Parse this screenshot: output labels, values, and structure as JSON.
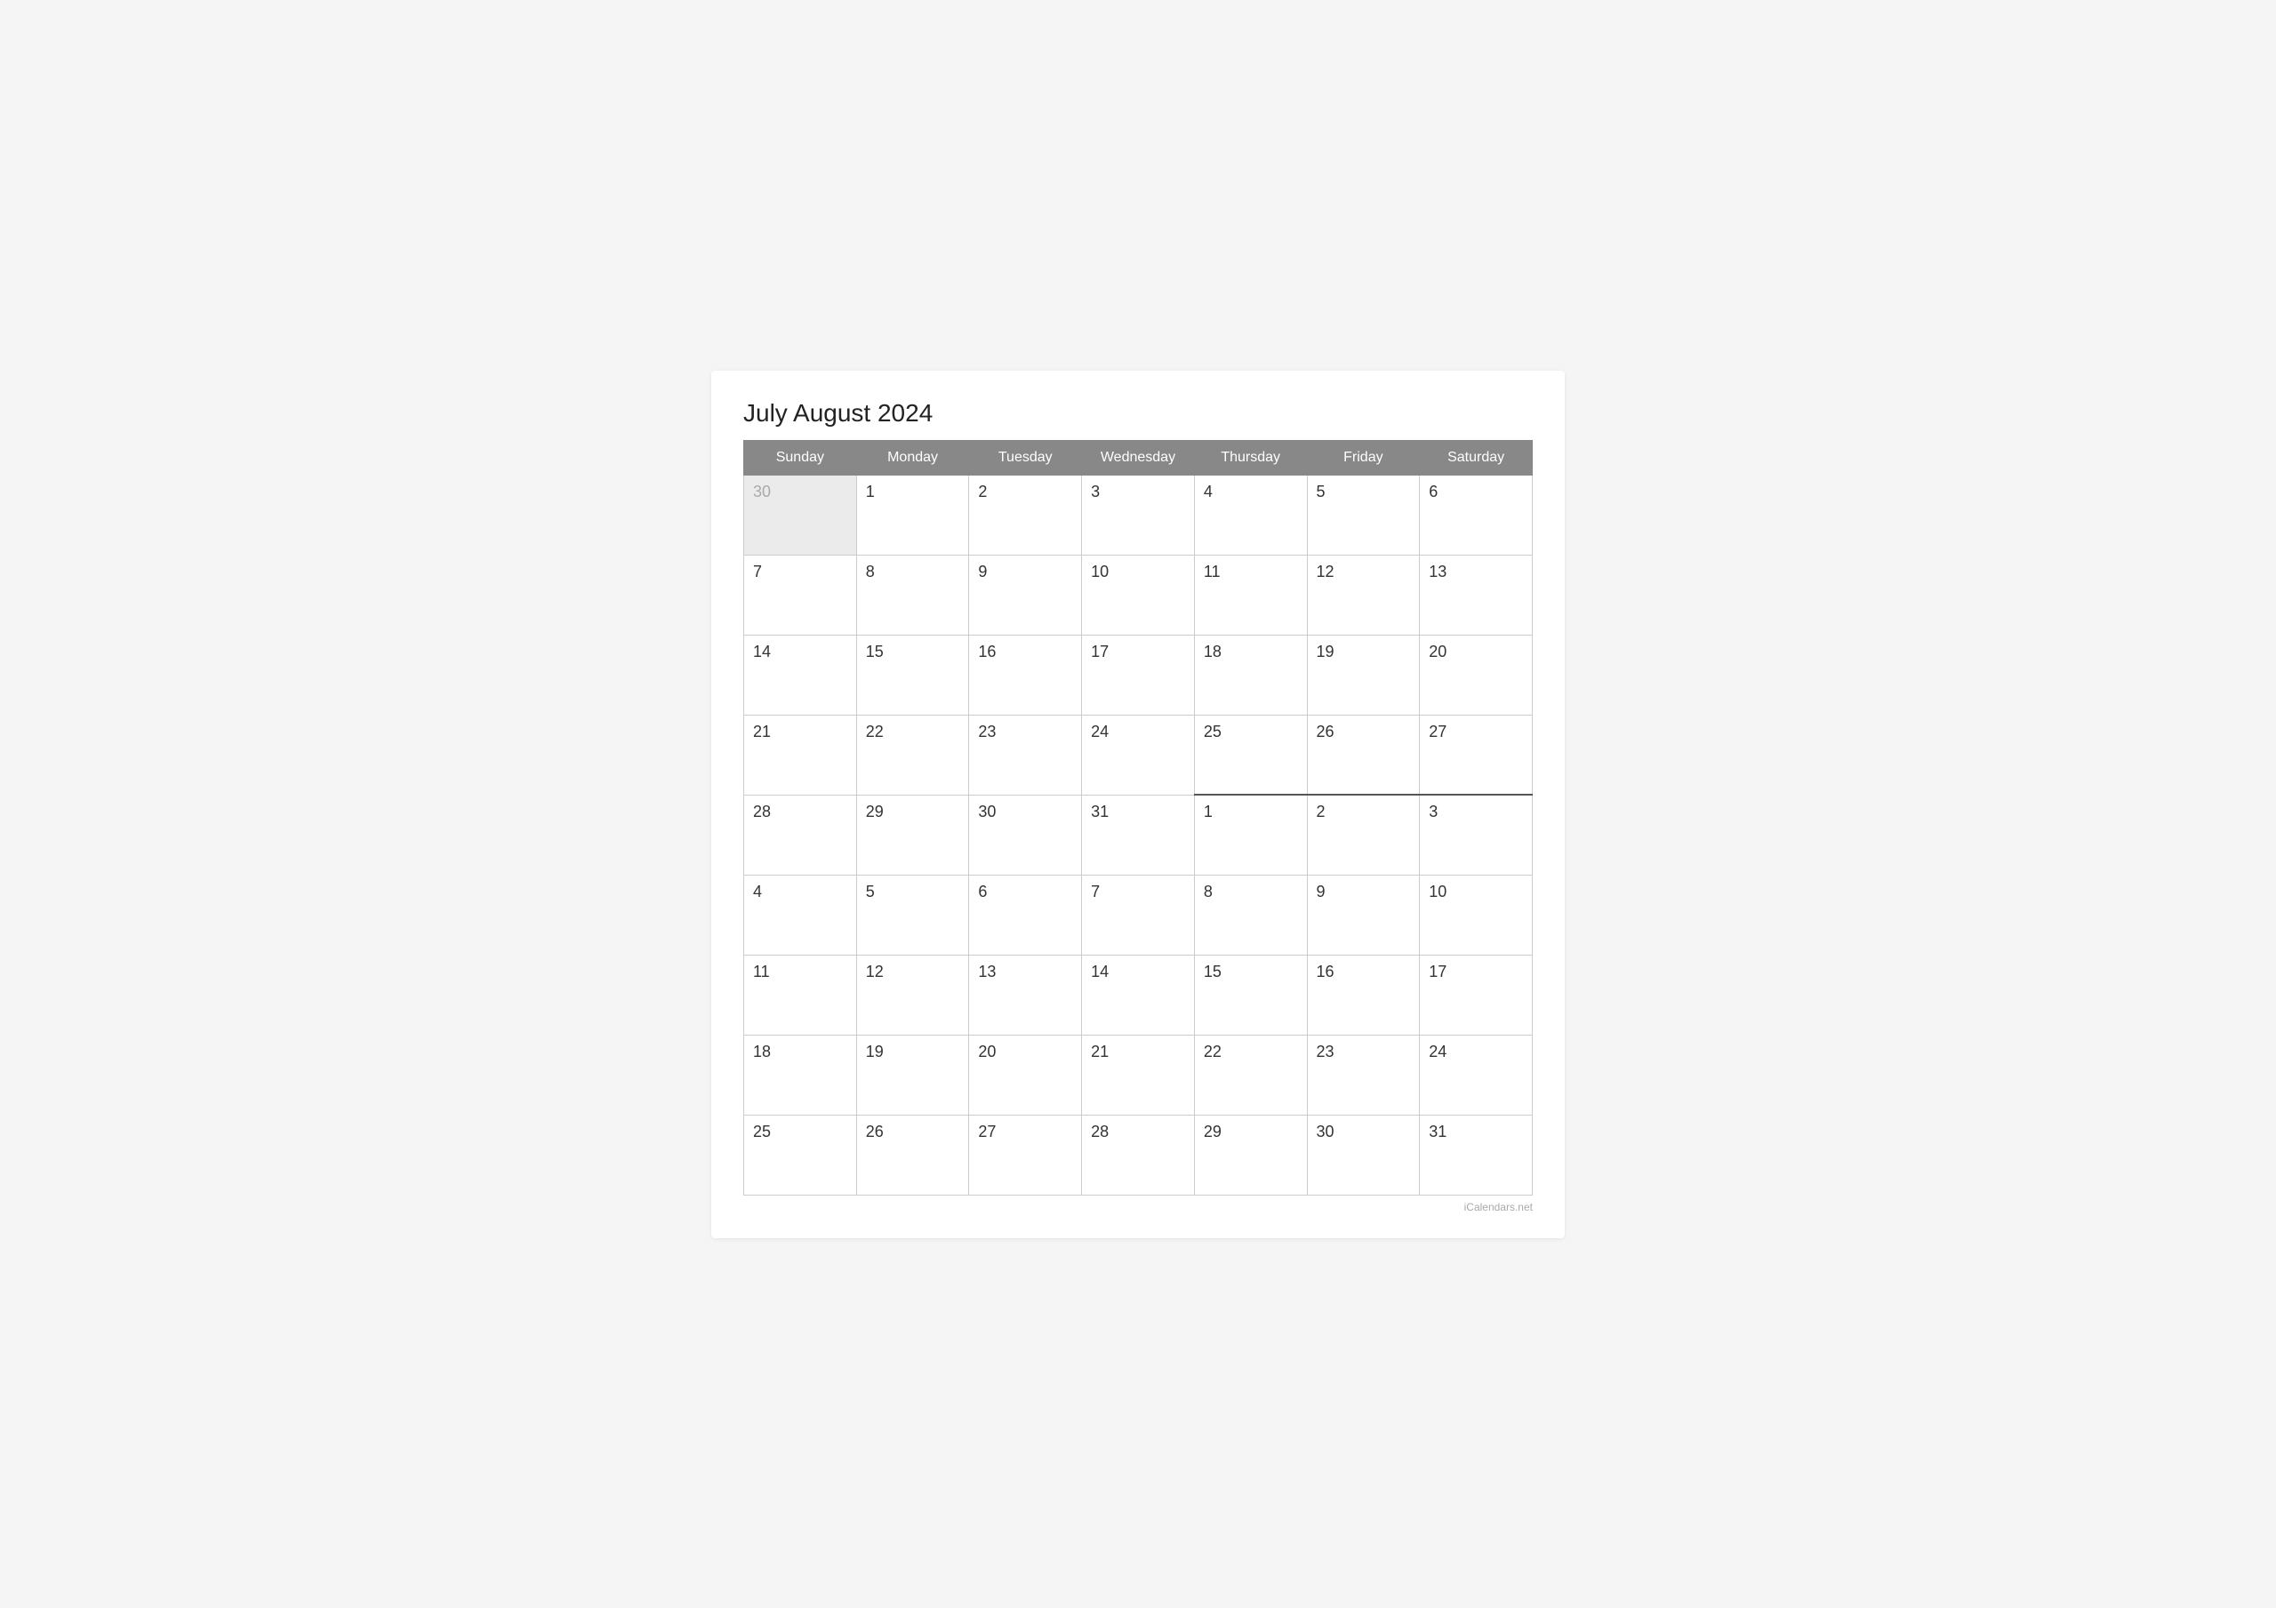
{
  "title": "July August 2024",
  "watermark": "iCalendars.net",
  "headers": [
    "Sunday",
    "Monday",
    "Tuesday",
    "Wednesday",
    "Thursday",
    "Friday",
    "Saturday"
  ],
  "rows": [
    [
      {
        "day": "30",
        "outside": true
      },
      {
        "day": "1",
        "outside": false
      },
      {
        "day": "2",
        "outside": false
      },
      {
        "day": "3",
        "outside": false
      },
      {
        "day": "4",
        "outside": false
      },
      {
        "day": "5",
        "outside": false
      },
      {
        "day": "6",
        "outside": false
      }
    ],
    [
      {
        "day": "7",
        "outside": false
      },
      {
        "day": "8",
        "outside": false
      },
      {
        "day": "9",
        "outside": false
      },
      {
        "day": "10",
        "outside": false
      },
      {
        "day": "11",
        "outside": false
      },
      {
        "day": "12",
        "outside": false
      },
      {
        "day": "13",
        "outside": false
      }
    ],
    [
      {
        "day": "14",
        "outside": false
      },
      {
        "day": "15",
        "outside": false
      },
      {
        "day": "16",
        "outside": false
      },
      {
        "day": "17",
        "outside": false
      },
      {
        "day": "18",
        "outside": false
      },
      {
        "day": "19",
        "outside": false
      },
      {
        "day": "20",
        "outside": false
      }
    ],
    [
      {
        "day": "21",
        "outside": false
      },
      {
        "day": "22",
        "outside": false
      },
      {
        "day": "23",
        "outside": false
      },
      {
        "day": "24",
        "outside": false
      },
      {
        "day": "25",
        "outside": false
      },
      {
        "day": "26",
        "outside": false
      },
      {
        "day": "27",
        "outside": false
      }
    ],
    [
      {
        "day": "28",
        "outside": false
      },
      {
        "day": "29",
        "outside": false
      },
      {
        "day": "30",
        "outside": false
      },
      {
        "day": "31",
        "outside": false
      },
      {
        "day": "1",
        "outside": false,
        "augustStart": true
      },
      {
        "day": "2",
        "outside": false,
        "augustStart": true
      },
      {
        "day": "3",
        "outside": false,
        "augustStart": true
      }
    ],
    [
      {
        "day": "4",
        "outside": false
      },
      {
        "day": "5",
        "outside": false
      },
      {
        "day": "6",
        "outside": false
      },
      {
        "day": "7",
        "outside": false
      },
      {
        "day": "8",
        "outside": false
      },
      {
        "day": "9",
        "outside": false
      },
      {
        "day": "10",
        "outside": false
      }
    ],
    [
      {
        "day": "11",
        "outside": false
      },
      {
        "day": "12",
        "outside": false
      },
      {
        "day": "13",
        "outside": false
      },
      {
        "day": "14",
        "outside": false
      },
      {
        "day": "15",
        "outside": false
      },
      {
        "day": "16",
        "outside": false
      },
      {
        "day": "17",
        "outside": false
      }
    ],
    [
      {
        "day": "18",
        "outside": false
      },
      {
        "day": "19",
        "outside": false
      },
      {
        "day": "20",
        "outside": false
      },
      {
        "day": "21",
        "outside": false
      },
      {
        "day": "22",
        "outside": false
      },
      {
        "day": "23",
        "outside": false
      },
      {
        "day": "24",
        "outside": false
      }
    ],
    [
      {
        "day": "25",
        "outside": false
      },
      {
        "day": "26",
        "outside": false
      },
      {
        "day": "27",
        "outside": false
      },
      {
        "day": "28",
        "outside": false
      },
      {
        "day": "29",
        "outside": false
      },
      {
        "day": "30",
        "outside": false
      },
      {
        "day": "31",
        "outside": false
      }
    ]
  ]
}
